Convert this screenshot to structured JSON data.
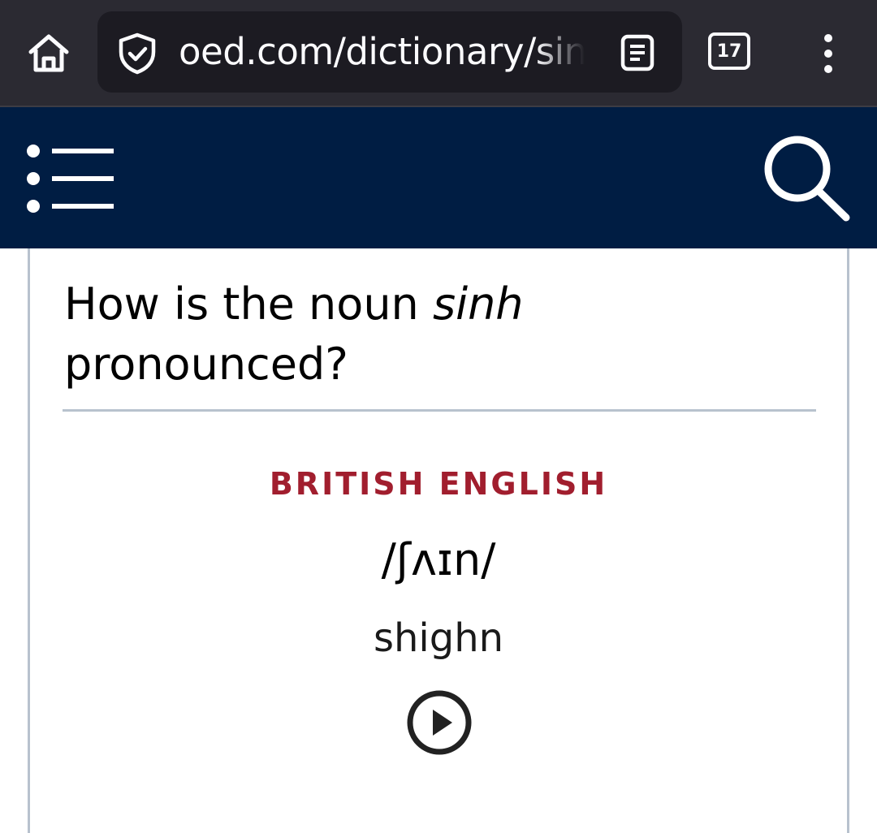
{
  "browser": {
    "url": "oed.com/dictionary/sinh_n",
    "tab_count": "17",
    "icons": {
      "home": "home-icon",
      "security": "shield-check-icon",
      "reader": "reader-view-icon",
      "menu": "kebab-menu-icon"
    }
  },
  "site_header": {
    "background": "#001d43",
    "icons": {
      "menu": "list-menu-icon",
      "search": "search-icon"
    }
  },
  "pronunciation": {
    "question_prefix": "How is the noun ",
    "word": "sinh",
    "question_suffix": " pronounced?",
    "region": "BRITISH ENGLISH",
    "region_color": "#a11e2e",
    "ipa": "/ʃʌɪn/",
    "respelling": "shighn",
    "play_icon": "play-circle-icon"
  }
}
